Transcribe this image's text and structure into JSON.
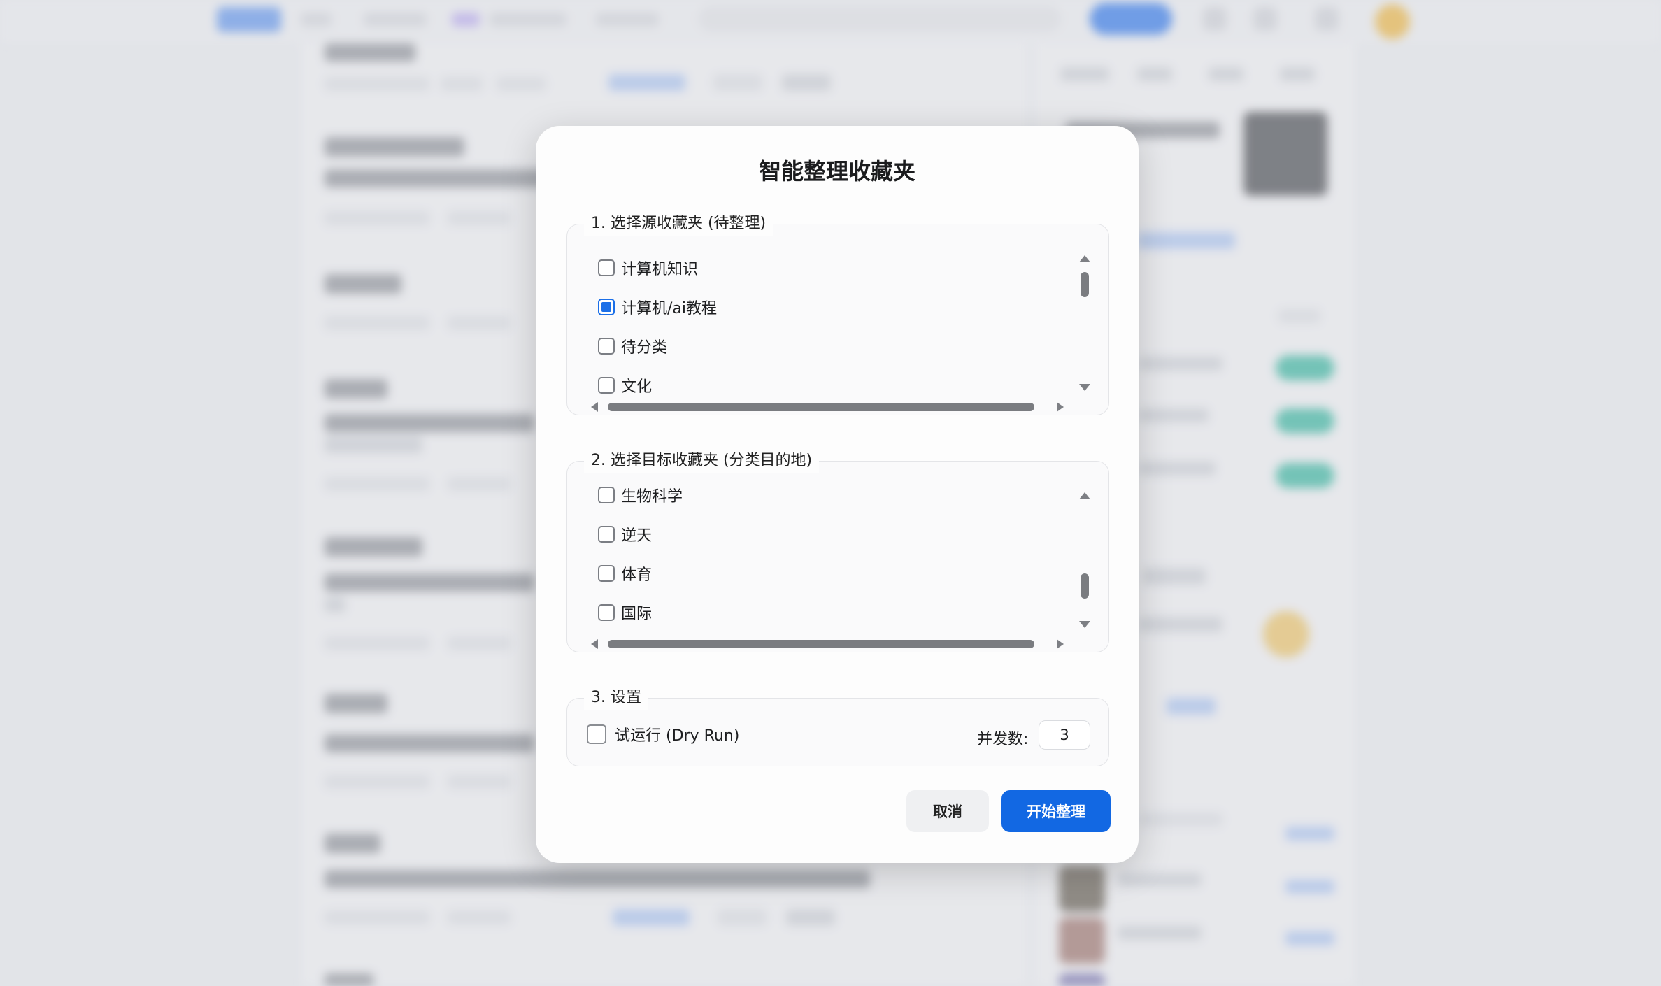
{
  "dialog": {
    "title": "智能整理收藏夹",
    "source_section": {
      "legend": "1. 选择源收藏夹 (待整理)",
      "items": [
        {
          "label": "计算机知识",
          "checked": false
        },
        {
          "label": "计算机/ai教程",
          "checked": true
        },
        {
          "label": "待分类",
          "checked": false
        },
        {
          "label": "文化",
          "checked": false
        }
      ]
    },
    "target_section": {
      "legend": "2. 选择目标收藏夹 (分类目的地)",
      "items": [
        {
          "label": "生物科学",
          "checked": false
        },
        {
          "label": "逆天",
          "checked": false
        },
        {
          "label": "体育",
          "checked": false
        },
        {
          "label": "国际",
          "checked": false
        }
      ]
    },
    "settings_section": {
      "legend": "3. 设置",
      "dry_run_label": "试运行 (Dry Run)",
      "dry_run_checked": false,
      "concurrency_label": "并发数:",
      "concurrency_value": "3"
    },
    "buttons": {
      "cancel": "取消",
      "start": "开始整理"
    }
  },
  "colors": {
    "accent": "#1268e3",
    "checkbox_checked": "#1b6fe8"
  },
  "icons": [
    "scroll-up-arrow-icon",
    "scroll-down-arrow-icon",
    "scroll-left-arrow-icon",
    "scroll-right-arrow-icon"
  ]
}
